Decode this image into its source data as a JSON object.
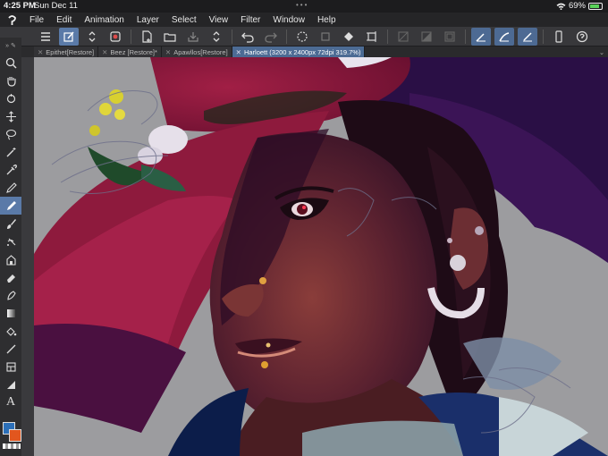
{
  "statusbar": {
    "time": "4:25 PM",
    "date": "Sun Dec 11",
    "battery": "69%"
  },
  "menubar": {
    "items": [
      "File",
      "Edit",
      "Animation",
      "Layer",
      "Select",
      "View",
      "Filter",
      "Window",
      "Help"
    ]
  },
  "tabs": [
    {
      "label": "Epithet[Restore]",
      "active": false
    },
    {
      "label": "Beez [Restore]*",
      "active": false
    },
    {
      "label": "Apawllos[Restore]",
      "active": false
    },
    {
      "label": "Harloett (3200 x 2400px 72dpi 319.7%)",
      "active": true
    }
  ],
  "colors": {
    "main_color": "#2b6fb8",
    "sub_color": "#e2561e",
    "accent": "#5a7aa8"
  },
  "toolbox": {
    "tools": [
      "zoom-icon",
      "hand-icon",
      "rotate-icon",
      "move-icon",
      "lasso-icon",
      "magic-wand-icon",
      "eyedropper-icon",
      "pen-icon",
      "pencil-icon",
      "brush-icon",
      "airbrush-icon",
      "decoration-icon",
      "eraser-icon",
      "blend-icon",
      "gradient-icon",
      "fill-icon",
      "line-icon",
      "frame-icon",
      "ruler-icon",
      "text-icon"
    ],
    "text_tool_label": "A"
  }
}
